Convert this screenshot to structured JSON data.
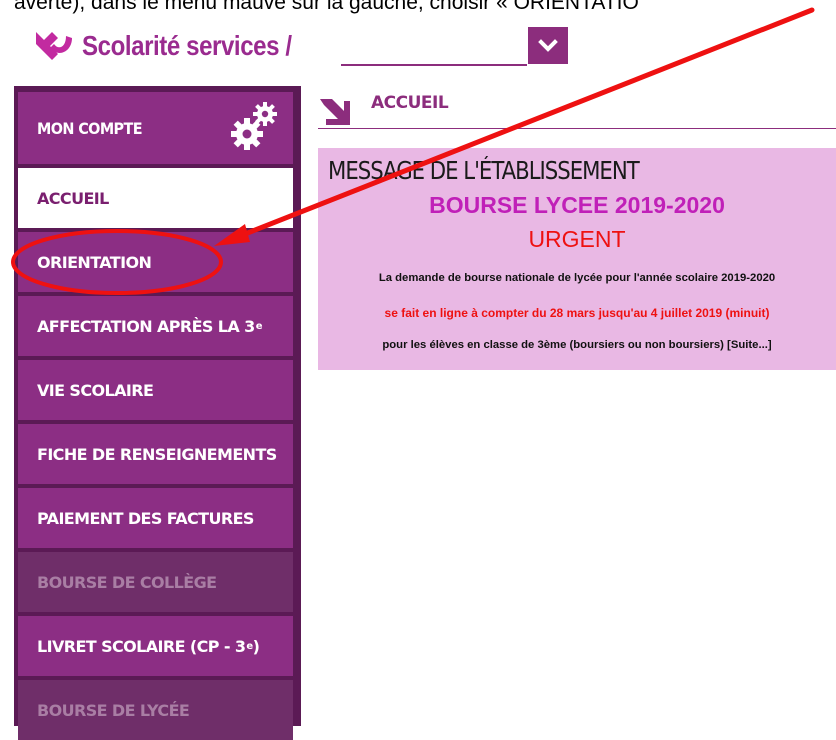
{
  "caption": "avérté), dans le menu mauve sur la gauche, choisir « ORIENTATIO",
  "header": {
    "brand": "Scolarité services /",
    "select_icon": "chevron-down-icon",
    "brand_color": "#9a2b8f",
    "accent_color": "#8c2d7d"
  },
  "sidebar": {
    "account": {
      "label": "MON COMPTE",
      "icon": "gears-icon"
    },
    "items": [
      {
        "label": "ACCUEIL",
        "sup": "",
        "state": "active"
      },
      {
        "label": "ORIENTATION",
        "sup": "",
        "state": "normal"
      },
      {
        "label": "AFFECTATION APRÈS LA 3",
        "sup": "e",
        "state": "normal"
      },
      {
        "label": "VIE SCOLAIRE",
        "sup": "",
        "state": "normal"
      },
      {
        "label": "FICHE DE RENSEIGNEMENTS",
        "sup": "",
        "state": "normal"
      },
      {
        "label": "PAIEMENT DES FACTURES",
        "sup": "",
        "state": "normal"
      },
      {
        "label": "BOURSE DE COLLÈGE",
        "sup": "",
        "state": "disabled"
      },
      {
        "label": "LIVRET SCOLAIRE (CP - 3",
        "sup": "e",
        "suffix": ")",
        "state": "normal"
      },
      {
        "label": "BOURSE DE LYCÉE",
        "sup": "",
        "state": "disabled"
      }
    ]
  },
  "breadcrumb": {
    "label": "ACCUEIL",
    "icon": "arrow-down-right-icon"
  },
  "message": {
    "title": "MESSAGE DE L'ÉTABLISSEMENT",
    "bourse": "BOURSE LYCEE 2019-2020",
    "urgent": "URGENT",
    "line1": "La demande de bourse nationale de lycée pour l'année scolaire 2019-2020",
    "line2": "se fait en ligne à compter du 28 mars jusqu'au 4 juillet 2019 (minuit)",
    "line3": "pour les élèves en classe de 3ème (boursiers ou non boursiers) [Suite...]"
  },
  "annotation": {
    "color": "#ee1111"
  }
}
